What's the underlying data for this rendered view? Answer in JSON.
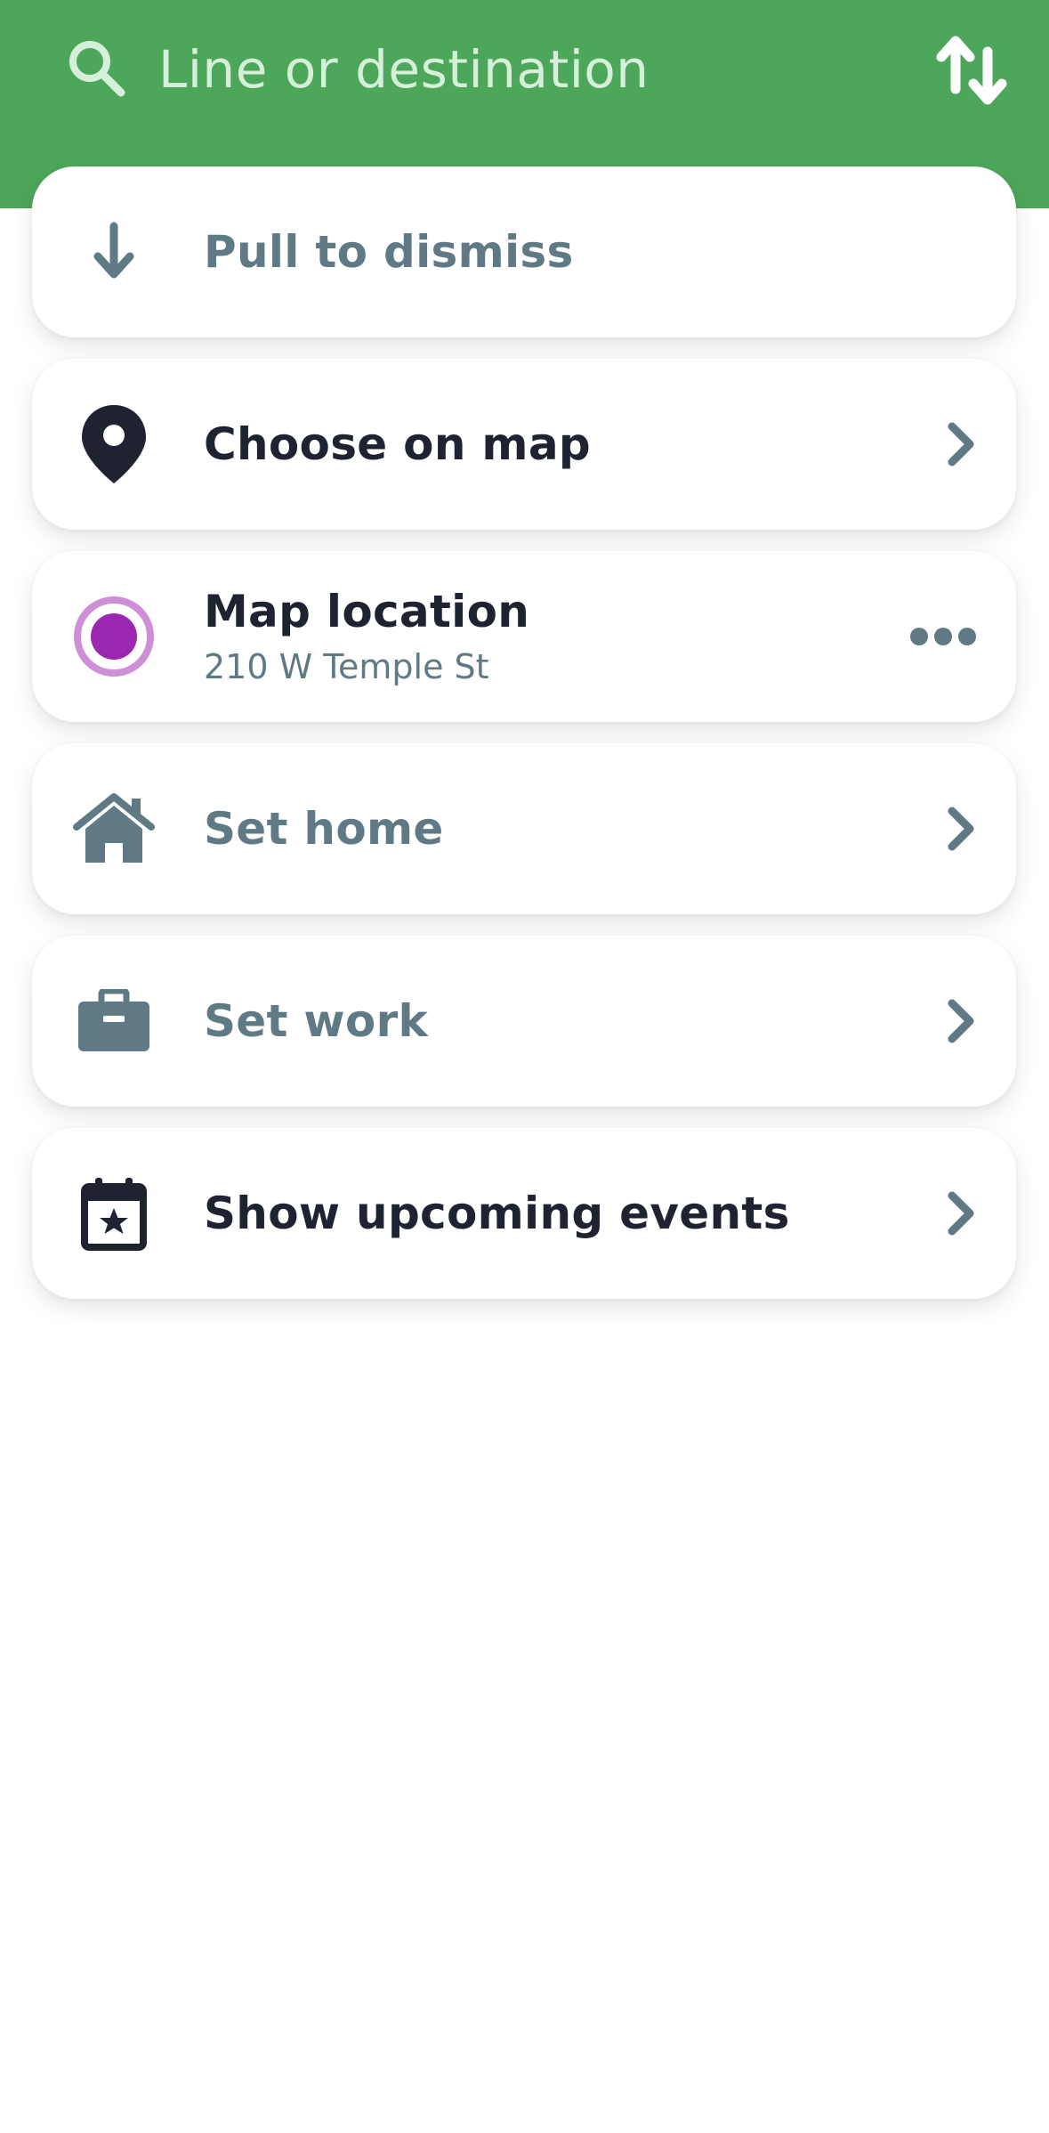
{
  "header": {
    "search_placeholder": "Line or destination",
    "search_icon": "search-icon",
    "swap_icon": "swap-icon"
  },
  "colors": {
    "header_green": "#4ca75a",
    "dark_text": "#1f2331",
    "gray_text": "#5f7a85",
    "accent_purple": "#9c27b0"
  },
  "menu": {
    "pull_to_dismiss": {
      "label": "Pull to dismiss",
      "icon": "arrow-down-icon"
    },
    "choose_on_map": {
      "label": "Choose on map",
      "icon": "map-pin-icon"
    },
    "map_location": {
      "title": "Map location",
      "address": "210 W Temple St",
      "icon": "location-target-icon"
    },
    "set_home": {
      "label": "Set home",
      "icon": "home-icon"
    },
    "set_work": {
      "label": "Set work",
      "icon": "briefcase-icon"
    },
    "upcoming_events": {
      "label": "Show upcoming events",
      "icon": "calendar-star-icon"
    }
  }
}
